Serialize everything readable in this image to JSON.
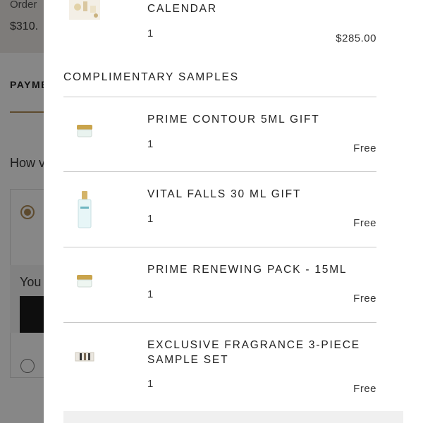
{
  "background": {
    "order_label": "Order",
    "order_total": "$310.",
    "payment_heading": "PAYME",
    "how_prompt": "How v",
    "you_text": "You"
  },
  "top_item": {
    "name": "CALENDAR",
    "qty": "1",
    "price": "$285.00",
    "icon": "calendar-product-icon"
  },
  "section_title": "COMPLIMENTARY SAMPLES",
  "samples": [
    {
      "name": "PRIME CONTOUR 5ML GIFT",
      "qty": "1",
      "price": "Free",
      "icon": "cream-jar-icon"
    },
    {
      "name": "VITAL FALLS 30 ML GIFT",
      "qty": "1",
      "price": "Free",
      "icon": "bottle-icon"
    },
    {
      "name": "PRIME RENEWING PACK - 15ML",
      "qty": "1",
      "price": "Free",
      "icon": "cream-jar-icon"
    },
    {
      "name": "EXCLUSIVE FRAGRANCE 3-PIECE SAMPLE SET",
      "qty": "1",
      "price": "Free",
      "icon": "fragrance-set-icon"
    }
  ],
  "colors": {
    "accent": "#b08d57",
    "overlay": "rgba(0,0,0,0.47)",
    "divider": "#c8c8c8"
  }
}
